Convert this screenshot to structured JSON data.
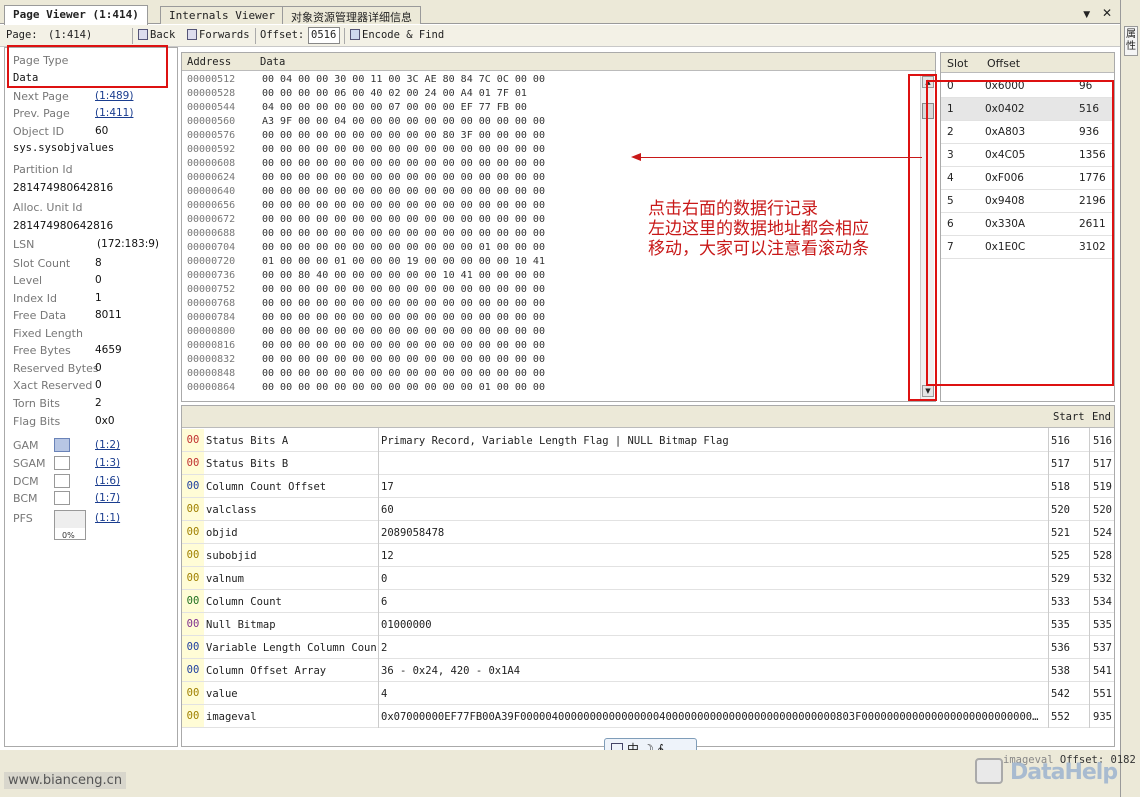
{
  "tabs": [
    {
      "label": "Page Viewer (1:414)",
      "active": true
    },
    {
      "label": "Internals Viewer",
      "active": false
    },
    {
      "label": "对象资源管理器详细信息",
      "active": false
    }
  ],
  "tab_controls": {
    "dropdown": "▼",
    "close": "✕"
  },
  "right_strip_label": "属性",
  "toolbar": {
    "page_label": "Page:",
    "page_value": "(1:414)",
    "back_label": "Back",
    "forwards_label": "Forwards",
    "offset_label": "Offset:",
    "offset_value": "0516",
    "encode_find_label": "Encode & Find"
  },
  "left_panel": {
    "page_type_label": "Page Type",
    "page_type_value": "Data",
    "next_page_label": "Next Page",
    "next_page_value": "(1:489)",
    "prev_page_label": "Prev. Page",
    "prev_page_value": "(1:411)",
    "object_id_label": "Object ID",
    "object_id_value": "60",
    "object_name": "sys.sysobjvalues",
    "partition_id_label": "Partition Id",
    "partition_id_value": "281474980642816",
    "alloc_unit_id_label": "Alloc. Unit Id",
    "alloc_unit_id_value": "281474980642816",
    "lsn_label": "LSN",
    "lsn_value": "(172:183:9)",
    "slot_count_label": "Slot Count",
    "slot_count_value": "8",
    "level_label": "Level",
    "level_value": "0",
    "index_id_label": "Index Id",
    "index_id_value": "1",
    "free_data_label": "Free Data",
    "free_data_value": "8011",
    "fixed_length_label": "Fixed Length",
    "free_bytes_label": "Free Bytes",
    "free_bytes_value": "4659",
    "reserved_bytes_label": "Reserved Bytes",
    "reserved_bytes_value": "0",
    "xact_reserved_label": "Xact Reserved",
    "xact_reserved_value": "0",
    "torn_bits_label": "Torn Bits",
    "torn_bits_value": "2",
    "flag_bits_label": "Flag Bits",
    "flag_bits_value": "0x0",
    "gam_label": "GAM",
    "gam_link": "(1:2)",
    "sgam_label": "SGAM",
    "sgam_link": "(1:3)",
    "dcm_label": "DCM",
    "dcm_link": "(1:6)",
    "bcm_label": "BCM",
    "bcm_link": "(1:7)",
    "pfs_label": "PFS",
    "pfs_link": "(1:1)",
    "pfs_percent": "0%"
  },
  "hex_view": {
    "address_header": "Address",
    "data_header": "Data",
    "rows": [
      {
        "addr": "00000512",
        "bytes": "00 04 00 00 30 00 11 00 3C AE 80 84 7C 0C 00 00"
      },
      {
        "addr": "00000528",
        "bytes": "00 00 00 00 06 00 40 02 00 24 00 A4 01 7F 01"
      },
      {
        "addr": "00000544",
        "bytes": "04 00 00 00 00 00 00 07 00 00 00 EF 77 FB 00"
      },
      {
        "addr": "00000560",
        "bytes": "A3 9F 00 00 04 00 00 00 00 00 00 00 00 00 00 00"
      },
      {
        "addr": "00000576",
        "bytes": "00 00 00 00 00 00 00 00 00 00 80 3F 00 00 00 00"
      },
      {
        "addr": "00000592",
        "bytes": "00 00 00 00 00 00 00 00 00 00 00 00 00 00 00 00"
      },
      {
        "addr": "00000608",
        "bytes": "00 00 00 00 00 00 00 00 00 00 00 00 00 00 00 00"
      },
      {
        "addr": "00000624",
        "bytes": "00 00 00 00 00 00 00 00 00 00 00 00 00 00 00 00"
      },
      {
        "addr": "00000640",
        "bytes": "00 00 00 00 00 00 00 00 00 00 00 00 00 00 00 00"
      },
      {
        "addr": "00000656",
        "bytes": "00 00 00 00 00 00 00 00 00 00 00 00 00 00 00 00"
      },
      {
        "addr": "00000672",
        "bytes": "00 00 00 00 00 00 00 00 00 00 00 00 00 00 00 00"
      },
      {
        "addr": "00000688",
        "bytes": "00 00 00 00 00 00 00 00 00 00 00 00 00 00 00 00"
      },
      {
        "addr": "00000704",
        "bytes": "00 00 00 00 00 00 00 00 00 00 00 00 01 00 00 00"
      },
      {
        "addr": "00000720",
        "bytes": "01 00 00 00 01 00 00 00 19 00 00 00 00 00 10 41"
      },
      {
        "addr": "00000736",
        "bytes": "00 00 80 40 00 00 00 00 00 00 10 41 00 00 00 00"
      },
      {
        "addr": "00000752",
        "bytes": "00 00 00 00 00 00 00 00 00 00 00 00 00 00 00 00"
      },
      {
        "addr": "00000768",
        "bytes": "00 00 00 00 00 00 00 00 00 00 00 00 00 00 00 00"
      },
      {
        "addr": "00000784",
        "bytes": "00 00 00 00 00 00 00 00 00 00 00 00 00 00 00 00"
      },
      {
        "addr": "00000800",
        "bytes": "00 00 00 00 00 00 00 00 00 00 00 00 00 00 00 00"
      },
      {
        "addr": "00000816",
        "bytes": "00 00 00 00 00 00 00 00 00 00 00 00 00 00 00 00"
      },
      {
        "addr": "00000832",
        "bytes": "00 00 00 00 00 00 00 00 00 00 00 00 00 00 00 00"
      },
      {
        "addr": "00000848",
        "bytes": "00 00 00 00 00 00 00 00 00 00 00 00 00 00 00 00"
      },
      {
        "addr": "00000864",
        "bytes": "00 00 00 00 00 00 00 00 00 00 00 00 01 00 00 00"
      }
    ]
  },
  "slots": {
    "slot_header": "Slot",
    "offset_header": "Offset",
    "rows": [
      {
        "slot": "0",
        "hex": "0x6000",
        "dec": "96"
      },
      {
        "slot": "1",
        "hex": "0x0402",
        "dec": "516"
      },
      {
        "slot": "2",
        "hex": "0xA803",
        "dec": "936"
      },
      {
        "slot": "3",
        "hex": "0x4C05",
        "dec": "1356"
      },
      {
        "slot": "4",
        "hex": "0xF006",
        "dec": "1776"
      },
      {
        "slot": "5",
        "hex": "0x9408",
        "dec": "2196"
      },
      {
        "slot": "6",
        "hex": "0x330A",
        "dec": "2611"
      },
      {
        "slot": "7",
        "hex": "0x1E0C",
        "dec": "3102"
      }
    ]
  },
  "annotation": {
    "line1": "点击右面的数据行记录",
    "line2": "左边这里的数据地址都会相应",
    "line3": "移动，大家可以注意看滚动条"
  },
  "fields": {
    "start_header": "Start",
    "end_header": "End",
    "rows": [
      {
        "code": "00",
        "code_color": "#c03030",
        "name": "Status Bits A",
        "value": "Primary Record, Variable Length Flag | NULL Bitmap Flag",
        "start": "516",
        "end": "516"
      },
      {
        "code": "00",
        "code_color": "#c03030",
        "name": "Status Bits B",
        "value": "",
        "start": "517",
        "end": "517"
      },
      {
        "code": "00",
        "code_color": "#2040a0",
        "name": "Column Count Offset",
        "value": "17",
        "start": "518",
        "end": "519"
      },
      {
        "code": "00",
        "code_color": "#a08000",
        "name": "valclass",
        "value": "60",
        "start": "520",
        "end": "520"
      },
      {
        "code": "00",
        "code_color": "#a08000",
        "name": "objid",
        "value": "2089058478",
        "start": "521",
        "end": "524"
      },
      {
        "code": "00",
        "code_color": "#a08000",
        "name": "subobjid",
        "value": "12",
        "start": "525",
        "end": "528"
      },
      {
        "code": "00",
        "code_color": "#a08000",
        "name": "valnum",
        "value": "0",
        "start": "529",
        "end": "532"
      },
      {
        "code": "00",
        "code_color": "#207020",
        "name": "Column Count",
        "value": "6",
        "start": "533",
        "end": "534"
      },
      {
        "code": "00",
        "code_color": "#803090",
        "name": "Null Bitmap",
        "value": "01000000",
        "start": "535",
        "end": "535"
      },
      {
        "code": "00",
        "code_color": "#2040a0",
        "name": "Variable Length Column Count",
        "value": "2",
        "start": "536",
        "end": "537"
      },
      {
        "code": "00",
        "code_color": "#2040a0",
        "name": "Column Offset Array",
        "value": "36 - 0x24, 420 - 0x1A4",
        "start": "538",
        "end": "541"
      },
      {
        "code": "00",
        "code_color": "#a08000",
        "name": "value",
        "value": "4",
        "start": "542",
        "end": "551"
      },
      {
        "code": "00",
        "code_color": "#a08000",
        "name": "imageval",
        "value": "0x07000000EF77FB00A39F00000400000000000000004000000000000000000000000000803F000000000000000000000000000000...",
        "start": "552",
        "end": "935"
      }
    ]
  },
  "ime_toolbar": "中 ☽ ∳",
  "status": {
    "field": "imageval",
    "offset_label": "Offset:",
    "offset_value": "0182"
  },
  "watermark": "www.bianceng.cn",
  "logo_text": "DataHelp"
}
